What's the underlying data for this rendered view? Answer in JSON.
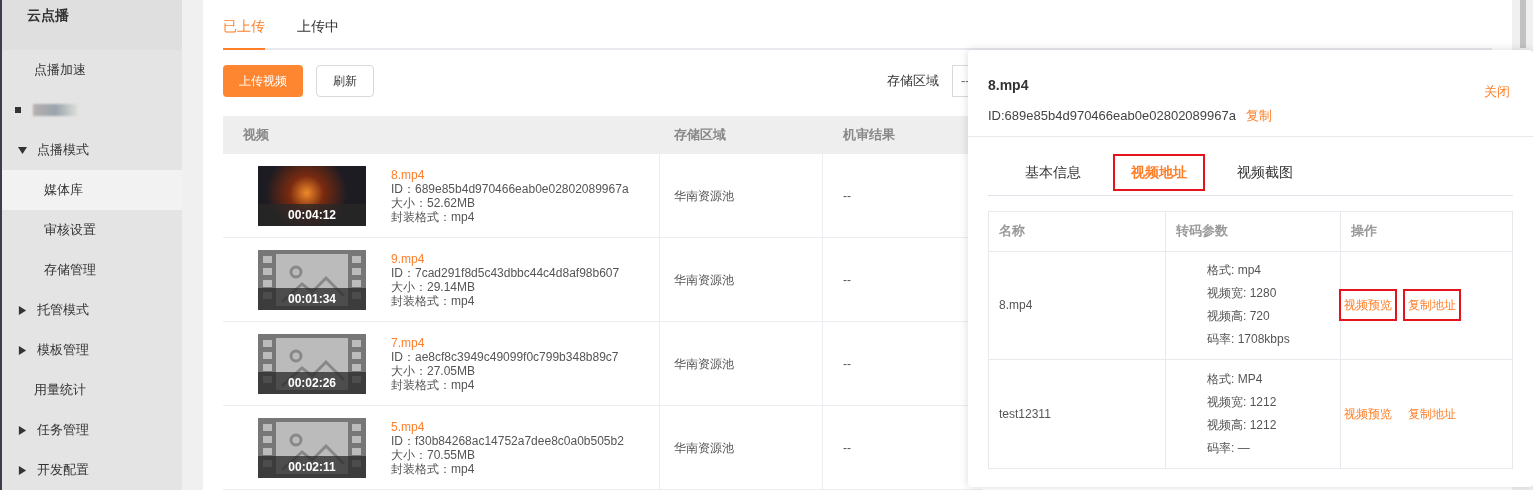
{
  "sidebar": {
    "title": "云点播",
    "items": [
      {
        "label": "点播加速",
        "kind": "plain"
      },
      {
        "kind": "blurred"
      },
      {
        "label": "点播模式",
        "kind": "group",
        "expanded": true,
        "children": [
          {
            "label": "媒体库",
            "selected": true
          },
          {
            "label": "审核设置",
            "selected": false
          },
          {
            "label": "存储管理",
            "selected": false
          }
        ]
      },
      {
        "label": "托管模式",
        "kind": "group",
        "expanded": false
      },
      {
        "label": "模板管理",
        "kind": "group",
        "expanded": false
      },
      {
        "label": "用量统计",
        "kind": "plain"
      },
      {
        "label": "任务管理",
        "kind": "group",
        "expanded": false
      },
      {
        "label": "开发配置",
        "kind": "group",
        "expanded": false
      }
    ]
  },
  "tabs": [
    {
      "label": "已上传",
      "selected": true
    },
    {
      "label": "上传中",
      "selected": false
    }
  ],
  "toolbar": {
    "upload_button": "上传视频",
    "refresh_button": "刷新",
    "region_label": "存储区域",
    "region_value": "--"
  },
  "table": {
    "columns": [
      "视频",
      "存储区域",
      "机审结果"
    ],
    "rows": [
      {
        "kind": "photo",
        "duration": "00:04:12",
        "name": "8.mp4",
        "id": "ID：689e85b4d970466eab0e02802089967a",
        "size": "大小：52.62MB",
        "format": "封装格式：mp4",
        "region": "华南资源池",
        "review": "--"
      },
      {
        "kind": "placeholder",
        "duration": "00:01:34",
        "name": "9.mp4",
        "id": "ID：7cad291f8d5c43dbbc44c4d8af98b607",
        "size": "大小：29.14MB",
        "format": "封装格式：mp4",
        "region": "华南资源池",
        "review": "--"
      },
      {
        "kind": "placeholder",
        "duration": "00:02:26",
        "name": "7.mp4",
        "id": "ID：ae8cf8c3949c49099f0c799b348b89c7",
        "size": "大小：27.05MB",
        "format": "封装格式：mp4",
        "region": "华南资源池",
        "review": "--"
      },
      {
        "kind": "placeholder",
        "duration": "00:02:11",
        "name": "5.mp4",
        "id": "ID：f30b84268ac14752a7dee8c0a0b505b2",
        "size": "大小：70.55MB",
        "format": "封装格式：mp4",
        "region": "华南资源池",
        "review": "--"
      }
    ]
  },
  "panel": {
    "title": "8.mp4",
    "id": "ID:689e85b4d970466eab0e02802089967a",
    "copy_link": "复制",
    "close_link": "关闭",
    "tabs": [
      {
        "label": "基本信息",
        "selected": false,
        "highlighted": false
      },
      {
        "label": "视频地址",
        "selected": true,
        "highlighted": true
      },
      {
        "label": "视频截图",
        "selected": false,
        "highlighted": false
      }
    ],
    "columns": [
      "名称",
      "转码参数",
      "操作"
    ],
    "rows": [
      {
        "name": "8.mp4",
        "params": [
          "格式: mp4",
          "视频宽: 1280",
          "视频高: 720",
          "码率: 1708kbps"
        ],
        "actions": [
          {
            "label": "视频预览",
            "highlighted": true
          },
          {
            "label": "复制地址",
            "highlighted": true
          }
        ]
      },
      {
        "name": "test12311",
        "params": [
          "格式: MP4",
          "视频宽: 1212",
          "视频高: 1212",
          "码率: —"
        ],
        "actions": [
          {
            "label": "视频预览",
            "highlighted": false
          },
          {
            "label": "复制地址",
            "highlighted": false
          }
        ]
      }
    ]
  }
}
